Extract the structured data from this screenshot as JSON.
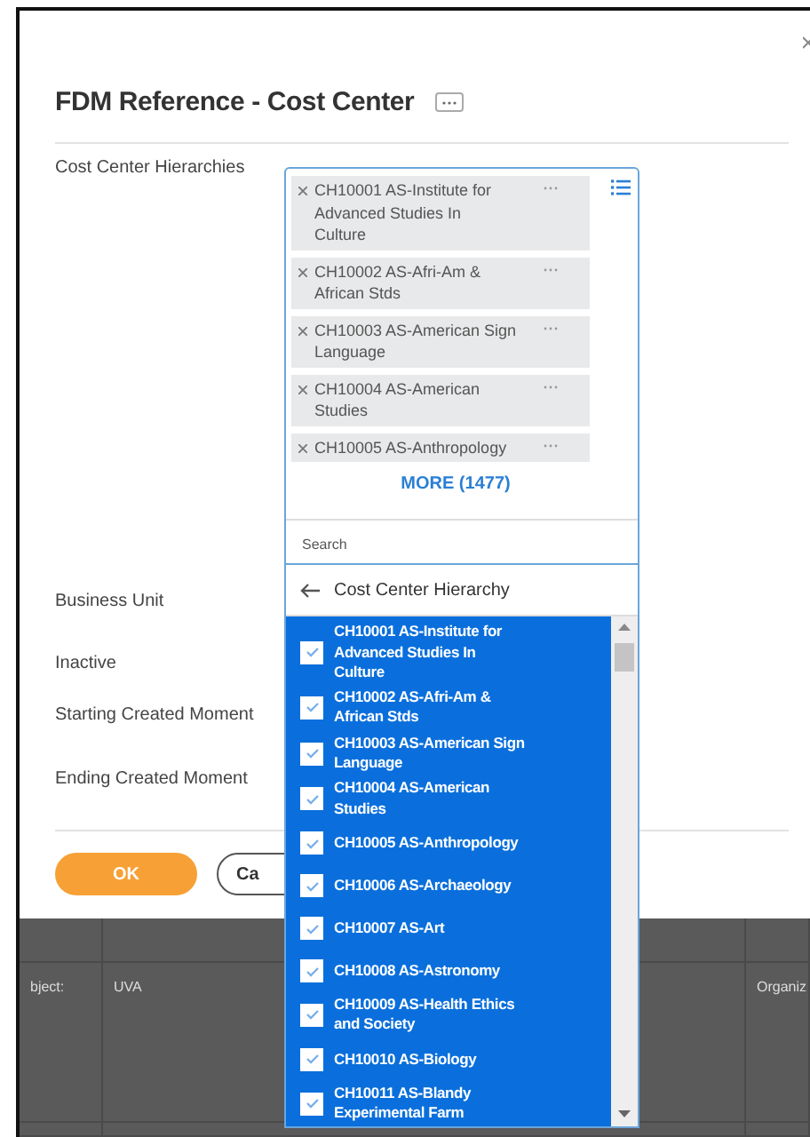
{
  "dialog": {
    "title": "FDM Reference - Cost Center",
    "fields": [
      {
        "label": "Cost Center Hierarchies",
        "kind": "prompt"
      },
      {
        "label": "Business Unit",
        "kind": "plain"
      },
      {
        "label": "Inactive",
        "kind": "plain"
      },
      {
        "label": "Starting Created Moment",
        "kind": "plain"
      },
      {
        "label": "Ending Created Moment",
        "kind": "plain"
      }
    ],
    "selected_items": [
      "CH10001 AS-Institute for Advanced Studies In Culture",
      "CH10002 AS-Afri-Am & African Stds",
      "CH10003 AS-American Sign Language",
      "CH10004 AS-American Studies",
      "CH10005 AS-Anthropology"
    ],
    "more_link": "MORE (1477)",
    "search": {
      "placeholder": "Search"
    },
    "buttons": [
      {
        "label": "OK",
        "kind": "primary"
      },
      {
        "label": "Ca",
        "kind": "secondary"
      }
    ]
  },
  "popup": {
    "title": "Cost Center Hierarchy",
    "options": [
      {
        "label": "CH10001 AS-Institute for Advanced Studies In Culture",
        "checked": true
      },
      {
        "label": "CH10002 AS-Afri-Am & African Stds",
        "checked": true
      },
      {
        "label": "CH10003 AS-American Sign Language",
        "checked": true
      },
      {
        "label": "CH10004 AS-American Studies",
        "checked": true
      },
      {
        "label": "CH10005 AS-Anthropology",
        "checked": true
      },
      {
        "label": "CH10006 AS-Archaeology",
        "checked": true
      },
      {
        "label": "CH10007 AS-Art",
        "checked": true
      },
      {
        "label": "CH10008 AS-Astronomy",
        "checked": true
      },
      {
        "label": "CH10009 AS-Health Ethics and Society",
        "checked": true
      },
      {
        "label": "CH10010 AS-Biology",
        "checked": true
      },
      {
        "label": "CH10011 AS-Blandy Experimental Farm",
        "checked": true
      }
    ]
  },
  "table": {
    "rows": [
      [
        "bject:",
        "UVA",
        "Organiz"
      ]
    ]
  }
}
